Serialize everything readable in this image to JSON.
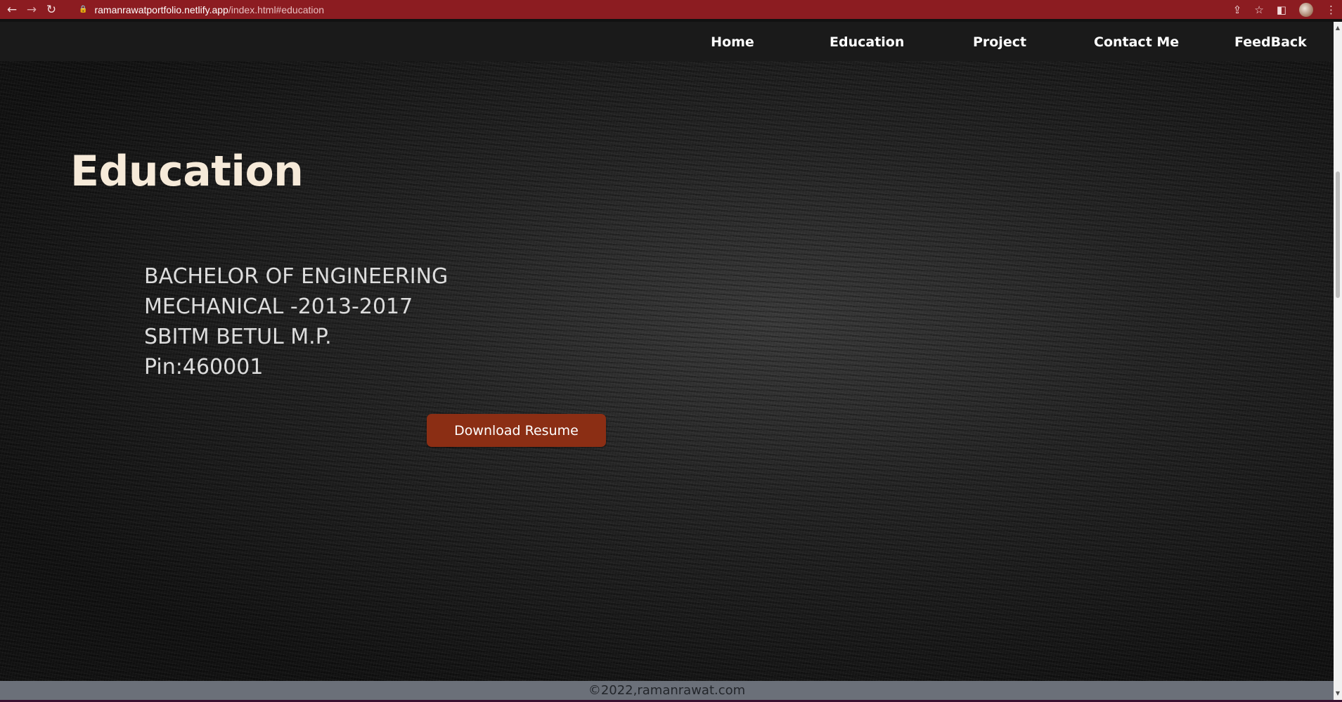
{
  "browser": {
    "url_host": "ramanrawatportfolio.netlify.app",
    "url_path": "/index.html#education",
    "icons": [
      "back-arrow-icon",
      "forward-arrow-icon",
      "reload-icon",
      "lock-icon",
      "share-icon",
      "bookmark-star-icon",
      "side-panel-icon",
      "profile-avatar",
      "more-menu-icon"
    ],
    "glyphs": {
      "back": "←",
      "forward": "→",
      "reload": "↻",
      "lock": "🔒",
      "share": "⇪",
      "star": "☆",
      "panel": "◧",
      "more": "⋮"
    },
    "accent_color": "#8c1c21"
  },
  "nav": {
    "items": [
      {
        "label": "Home"
      },
      {
        "label": "Education"
      },
      {
        "label": "Project"
      },
      {
        "label": "Contact Me"
      },
      {
        "label": "FeedBack"
      }
    ]
  },
  "education": {
    "title": "Education",
    "lines": [
      "BACHELOR OF ENGINEERING",
      "MECHANICAL -2013-2017",
      "SBITM BETUL M.P.",
      "Pin:460001"
    ],
    "download_label": "Download Resume",
    "button_color": "#8b2e14"
  },
  "footer": {
    "text": "©2022,ramanrawat.com"
  },
  "scrollbar": {
    "up_glyph": "▲",
    "down_glyph": "▼"
  }
}
